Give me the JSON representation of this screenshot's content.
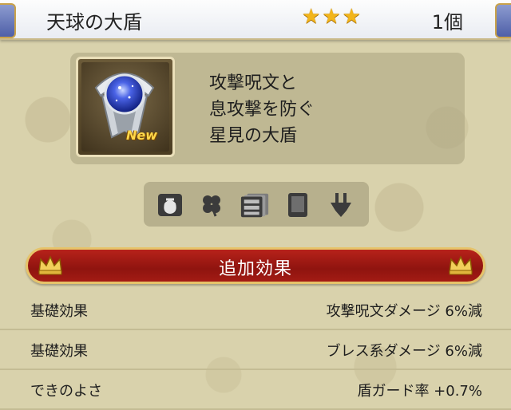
{
  "header": {
    "item_name": "天球の大盾",
    "stars": [
      "★",
      "★",
      "★"
    ],
    "quantity": "1個"
  },
  "item": {
    "badge": "New",
    "description_lines": [
      "攻撃呪文と",
      "息攻撃を防ぐ",
      "星見の大盾"
    ]
  },
  "category_icons": [
    "bag-icon",
    "clover-icon",
    "dresser-icon",
    "book-icon",
    "anchor-icon"
  ],
  "effects_section": {
    "title": "追加効果",
    "rows": [
      {
        "label": "基礎効果",
        "value": "攻撃呪文ダメージ 6%減"
      },
      {
        "label": "基礎効果",
        "value": "ブレス系ダメージ 6%減"
      },
      {
        "label": "できのよさ",
        "value": "盾ガード率 +0.7%"
      }
    ]
  },
  "colors": {
    "background": "#d9d2ac",
    "banner_red": "#a31b14",
    "gold": "#e6c36a",
    "star": "#f2b51b"
  }
}
